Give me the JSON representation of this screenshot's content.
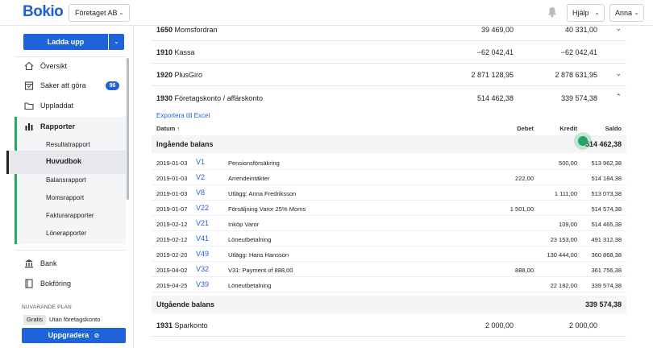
{
  "header": {
    "logo": "Bokio",
    "company": "Företaget AB",
    "help": "Hjälp",
    "user": "Anna"
  },
  "sidebar": {
    "upload": "Ladda upp",
    "items": [
      {
        "label": "Översikt"
      },
      {
        "label": "Saker att göra",
        "badge": "96"
      },
      {
        "label": "Uppladdat"
      },
      {
        "label": "Rapporter"
      }
    ],
    "reports": {
      "sub": [
        "Resultatrapport",
        "Huvudbok",
        "Balansrapport",
        "Momsrapport",
        "Fakturarapporter",
        "Lönerapporter"
      ]
    },
    "lower": [
      {
        "label": "Bank"
      },
      {
        "label": "Bokföring"
      }
    ],
    "plan": {
      "caption": "NUVARANDE PLAN",
      "tag": "Gratis",
      "text": "Utan företagskonto",
      "upgrade": "Uppgradera"
    }
  },
  "accounts": [
    {
      "number": "1650",
      "name": "Momsfordran",
      "v1": "39 469,00",
      "v2": "40 331,00"
    },
    {
      "number": "1910",
      "name": "Kassa",
      "v1": "−62 042,41",
      "v2": "−62 042,41"
    },
    {
      "number": "1920",
      "name": "PlusGiro",
      "v1": "2 871 128,95",
      "v2": "2 878 631,95"
    },
    {
      "number": "1930",
      "name": "Företagskonto / affärskonto",
      "v1": "514 462,38",
      "v2": "339 574,38"
    },
    {
      "number": "1931",
      "name": "Sparkonto",
      "v1": "2 000,00",
      "v2": "2 000,00"
    }
  ],
  "detail": {
    "export": "Exportera till Excel",
    "cols": {
      "datum": "Datum ↑",
      "debet": "Debet",
      "kredit": "Kredit",
      "saldo": "Saldo"
    },
    "opening": {
      "label": "Ingående balans",
      "value": "514 462,38"
    },
    "rows": [
      {
        "date": "2019-01-03",
        "ver": "V1",
        "desc": "Pensionsförsäkring",
        "debet": "",
        "kredit": "500,00",
        "saldo": "513 962,38"
      },
      {
        "date": "2019-01-03",
        "ver": "V2",
        "desc": "Arrendeintäkter",
        "debet": "222,00",
        "kredit": "",
        "saldo": "514 184,38"
      },
      {
        "date": "2019-01-03",
        "ver": "V8",
        "desc": "Utlägg: Anna Fredriksson",
        "debet": "",
        "kredit": "1 111,00",
        "saldo": "513 073,38"
      },
      {
        "date": "2019-01-07",
        "ver": "V22",
        "desc": "Försäljning Varor 25% Moms",
        "debet": "1 501,00",
        "kredit": "",
        "saldo": "514 574,38"
      },
      {
        "date": "2019-02-12",
        "ver": "V21",
        "desc": "Inköp Varor",
        "debet": "",
        "kredit": "109,00",
        "saldo": "514 465,38"
      },
      {
        "date": "2019-02-12",
        "ver": "V41",
        "desc": "Löneutbetalning",
        "debet": "",
        "kredit": "23 153,00",
        "saldo": "491 312,38"
      },
      {
        "date": "2019-02-20",
        "ver": "V49",
        "desc": "Utlägg: Hans Hansson",
        "debet": "",
        "kredit": "130 444,00",
        "saldo": "360 868,38"
      },
      {
        "date": "2019-04-02",
        "ver": "V32",
        "desc": "V31: Payment of 888,00",
        "debet": "888,00",
        "kredit": "",
        "saldo": "361 756,38"
      },
      {
        "date": "2019-04-25",
        "ver": "V39",
        "desc": "Löneutbetalning",
        "debet": "",
        "kredit": "22 182,00",
        "saldo": "339 574,38"
      }
    ],
    "closing": {
      "label": "Utgående balans",
      "value": "339 574,38"
    }
  },
  "colors": {
    "accent": "#1e63d9",
    "green": "#2aa564"
  }
}
